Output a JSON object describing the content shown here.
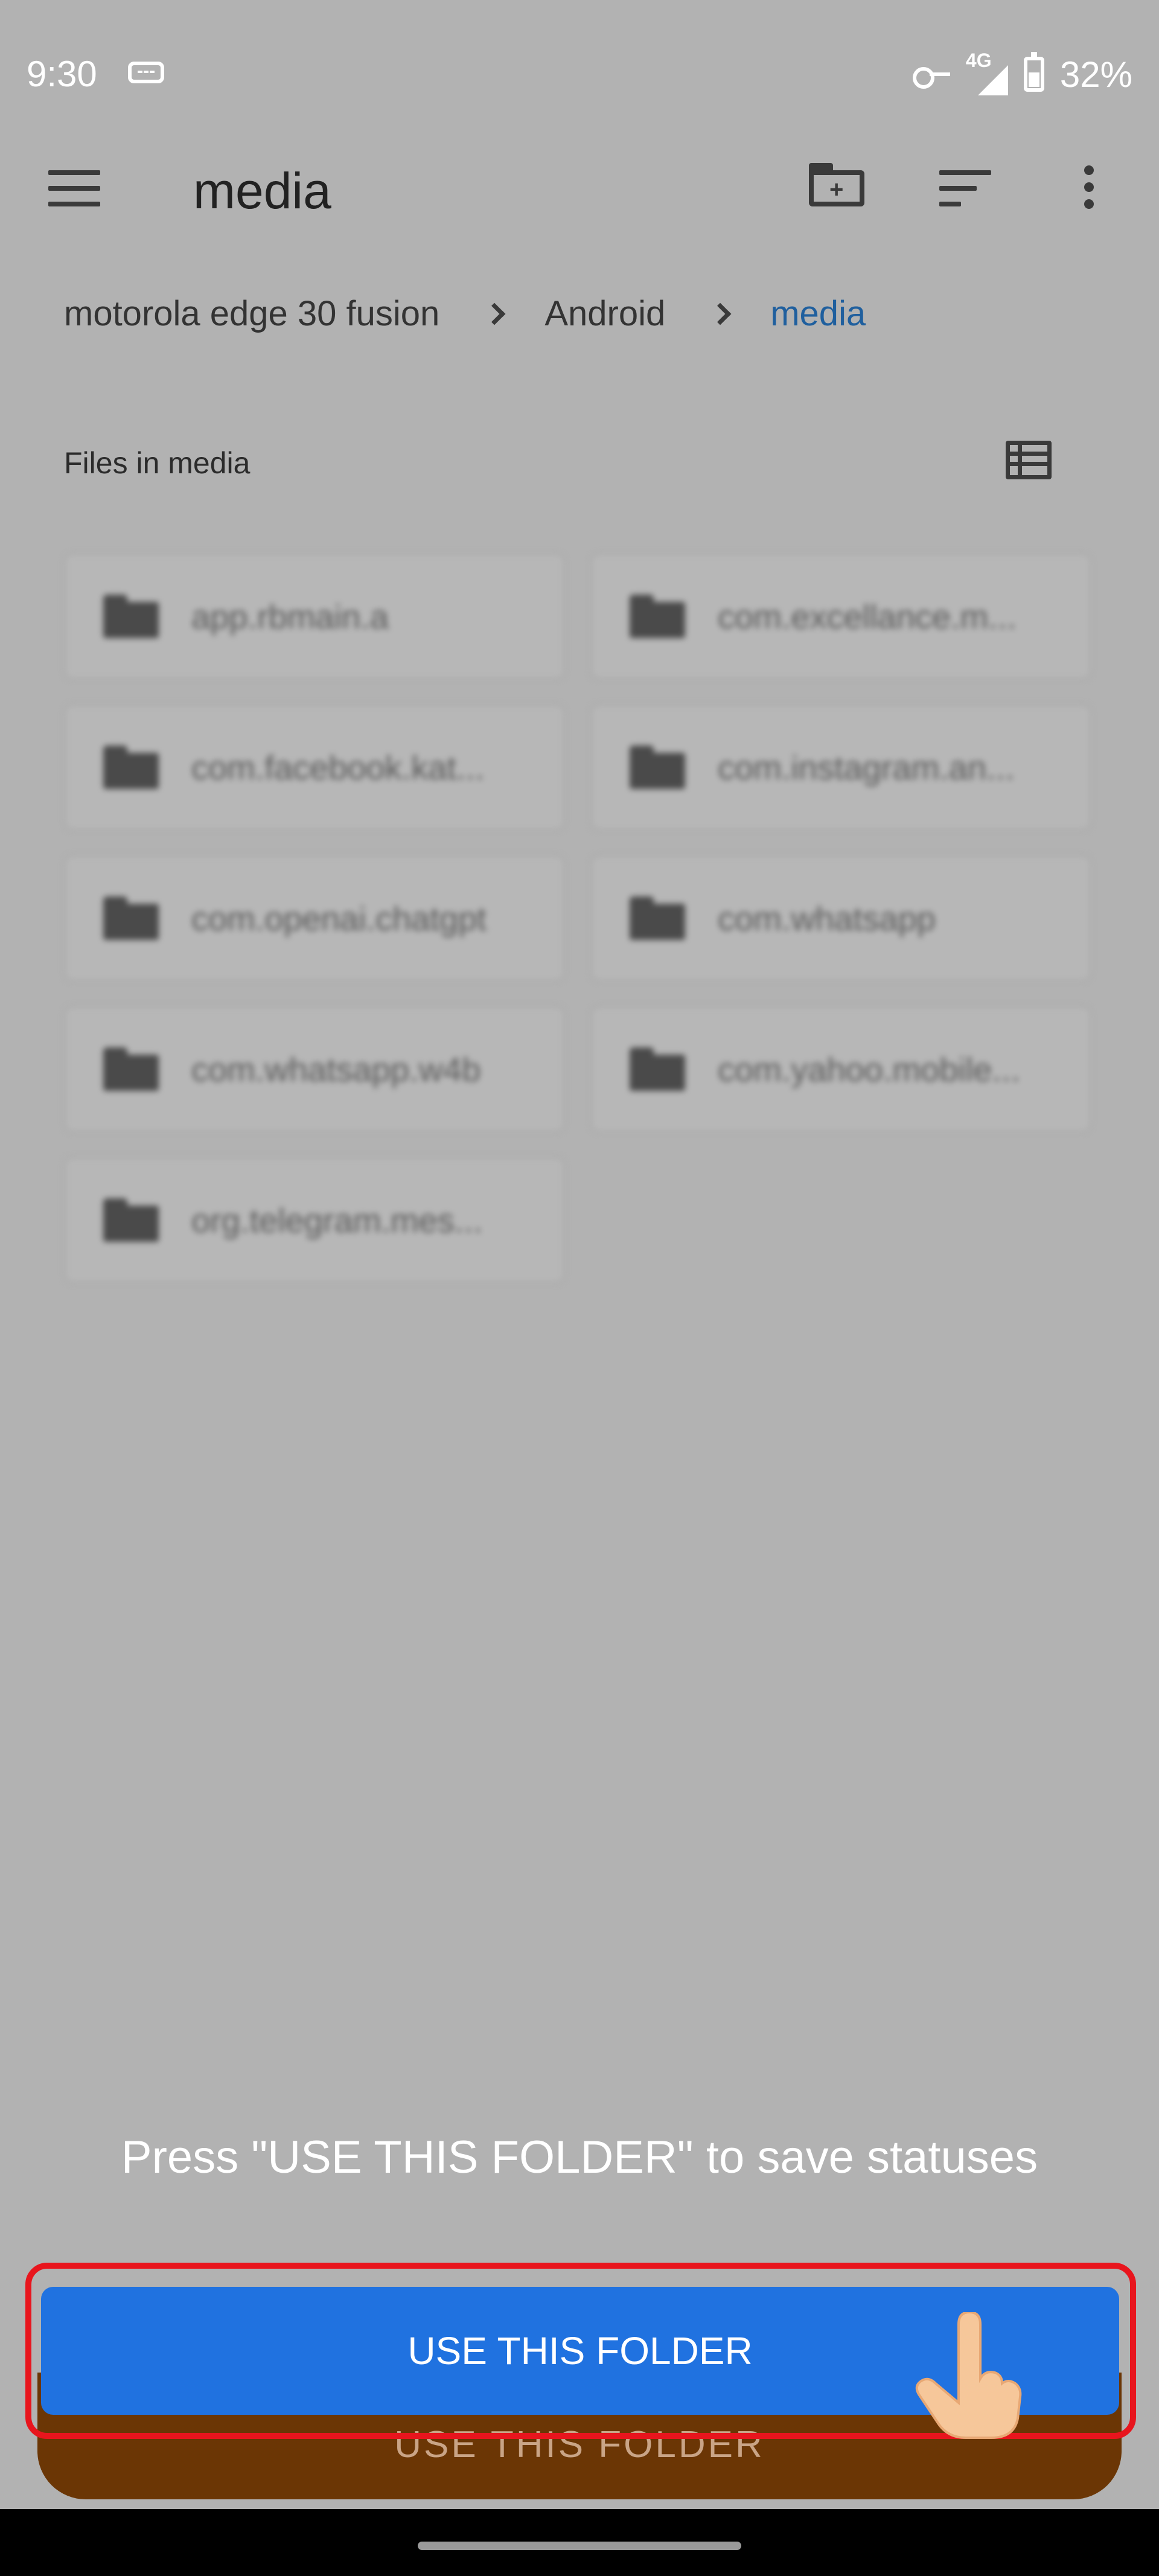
{
  "status_bar": {
    "time": "9:30",
    "network": "4G",
    "battery": "32%",
    "icons": [
      "screen-cast-icon",
      "vpn-key-icon",
      "signal-icon",
      "battery-icon"
    ]
  },
  "app_bar": {
    "title": "media",
    "icons": [
      "menu-icon",
      "new-folder-icon",
      "sort-icon",
      "more-vert-icon"
    ]
  },
  "breadcrumb": {
    "items": [
      "motorola edge 30 fusion",
      "Android",
      "media"
    ]
  },
  "files_section": {
    "header": "Files in media",
    "folders": [
      "app.rbmain.a",
      "com.excellance.m...",
      "com.facebook.kat...",
      "com.instagram.an...",
      "com.openai.chatgpt",
      "com.whatsapp",
      "com.whatsapp.w4b",
      "com.yahoo.mobile...",
      "org.telegram.mes..."
    ]
  },
  "prompt": {
    "text": "Press \"USE THIS FOLDER\" to save statuses"
  },
  "primary_button": {
    "label": "USE THIS FOLDER"
  },
  "background_button": {
    "label": "USE THIS FOLDER"
  },
  "colors": {
    "overlay": "#b2b2b2",
    "primary_button": "#2072e0",
    "background_button": "#6b3605",
    "highlight": "#e8151d",
    "breadcrumb_current": "#1f5f9e"
  }
}
